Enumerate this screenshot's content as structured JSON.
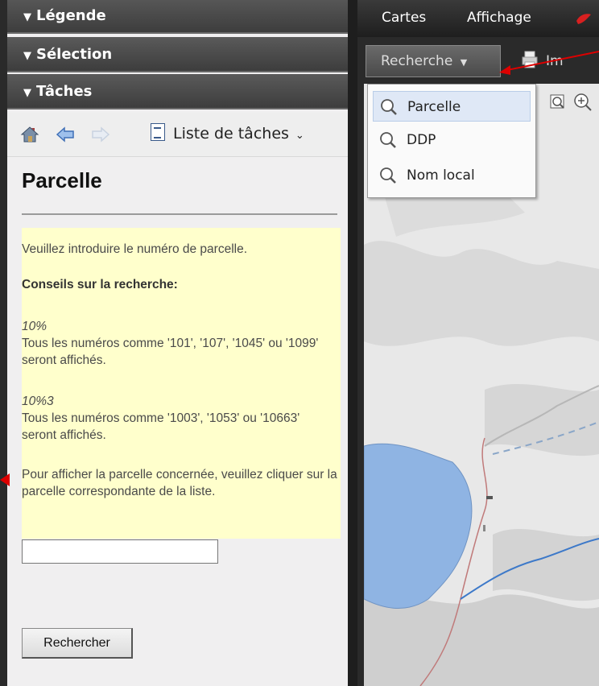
{
  "accordion": {
    "legende": "Légende",
    "selection": "Sélection",
    "taches": "Tâches"
  },
  "toolbar": {
    "task_list_label": "Liste de tâches"
  },
  "panel": {
    "title": "Parcelle",
    "help": {
      "intro": "Veuillez introduire le numéro de parcelle.",
      "tips_heading": "Conseils sur la recherche:",
      "ex1_pattern": "10%",
      "ex1_text": "Tous les numéros comme '101', '107', '1045' ou '1099' seront affichés.",
      "ex2_pattern": "10%3",
      "ex2_text": "Tous les numéros comme '1003', '1053' ou '10663' seront affichés.",
      "outro": "Pour afficher la parcelle concernée, veuillez cliquer sur la parcelle correspondante de la liste."
    },
    "input_value": "",
    "search_button": "Rechercher"
  },
  "menubar": {
    "cartes": "Cartes",
    "affichage": "Affichage"
  },
  "subbar": {
    "recherche": "Recherche",
    "imprimer": "Im"
  },
  "dropdown": {
    "items": [
      "Parcelle",
      "DDP",
      "Nom local"
    ],
    "selected": "Parcelle"
  },
  "colors": {
    "annotation_red": "#dd0000",
    "help_background": "#ffffcc",
    "water": "#8fb4e3"
  }
}
